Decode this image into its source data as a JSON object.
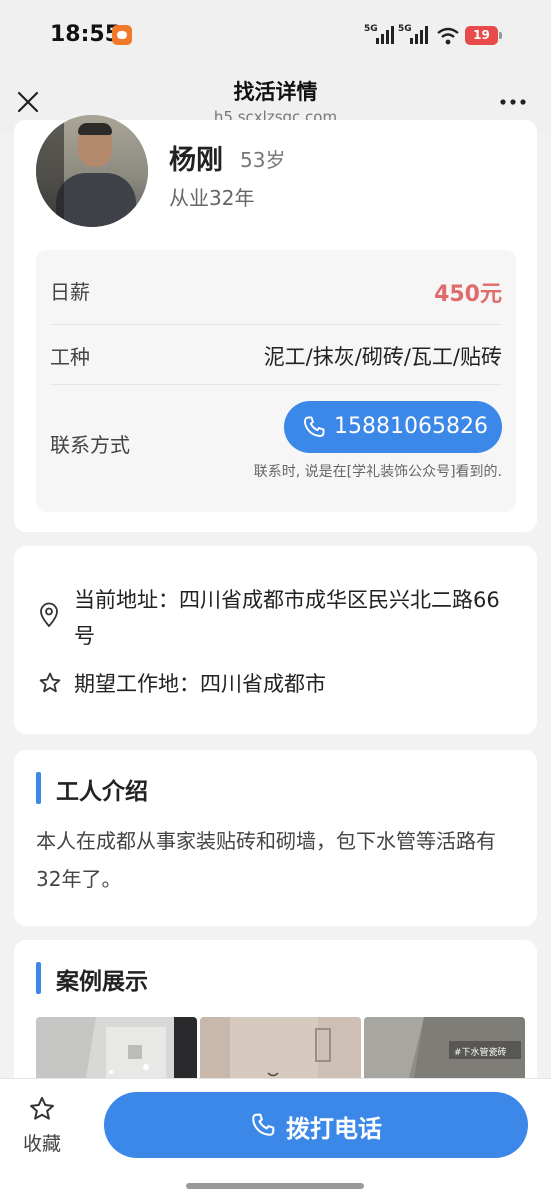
{
  "status_bar": {
    "time": "18:55",
    "signal1_label": "5G",
    "signal2_label": "5G",
    "battery": "19"
  },
  "header": {
    "title": "找活详情",
    "url": "h5.scxlzsgc.com"
  },
  "worker": {
    "name": "杨刚",
    "age": "53岁",
    "experience": "从业32年"
  },
  "info": {
    "wage_label": "日薪",
    "wage_value": "450元",
    "trade_label": "工种",
    "trade_value": "泥工/抹灰/砌砖/瓦工/贴砖",
    "contact_label": "联系方式",
    "phone": "15881065826",
    "contact_note": "联系时, 说是在[学礼装饰公众号]看到的."
  },
  "address": {
    "current": "当前地址：四川省成都市成华区民兴北二路66号",
    "expected": "期望工作地：四川省成都市"
  },
  "intro": {
    "title": "工人介绍",
    "text": "本人在成都从事家装贴砖和砌墙，包下水管等活路有32年了。"
  },
  "cases": {
    "title": "案例展示",
    "thumb3_watermark": "#下水管瓷砖"
  },
  "bottom": {
    "favorite_label": "收藏",
    "call_label": "拨打电话"
  },
  "colors": {
    "accent": "#3b88e8",
    "wage": "#e06b6b"
  }
}
